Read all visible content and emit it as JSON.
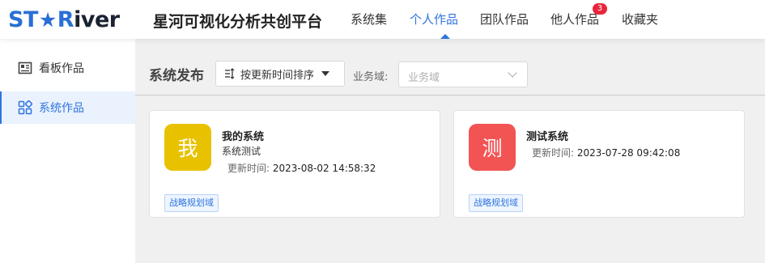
{
  "header": {
    "logo": {
      "part1": "ST",
      "part2": "R",
      "part3": "iver"
    },
    "app_title": "星河可视化分析共创平台",
    "nav": [
      {
        "label": "系统集"
      },
      {
        "label": "个人作品",
        "active": true
      },
      {
        "label": "团队作品"
      },
      {
        "label": "他人作品",
        "badge": "3"
      },
      {
        "label": "收藏夹"
      }
    ]
  },
  "sidebar": {
    "items": [
      {
        "label": "看板作品",
        "icon": "dashboard-icon"
      },
      {
        "label": "系统作品",
        "icon": "grid-icon",
        "active": true
      }
    ]
  },
  "toolbar": {
    "section_title": "系统发布",
    "sort_label": "按更新时间排序",
    "domain_label": "业务域:",
    "domain_placeholder": "业务域"
  },
  "cards": [
    {
      "avatar_char": "我",
      "avatar_color": "#e8c200",
      "name": "我的系统",
      "description": "系统测试",
      "time_label": "更新时间:",
      "time_value": "2023-08-02 14:58:32",
      "tag": "战略规划域"
    },
    {
      "avatar_char": "测",
      "avatar_color": "#f25454",
      "name": "测试系统",
      "time_label": "更新时间:",
      "time_value": "2023-07-28 09:42:08",
      "tag": "战略规划域"
    }
  ],
  "colors": {
    "accent": "#2f74e0",
    "badge": "#e8253b",
    "brand_blue": "#2a6fd6"
  }
}
